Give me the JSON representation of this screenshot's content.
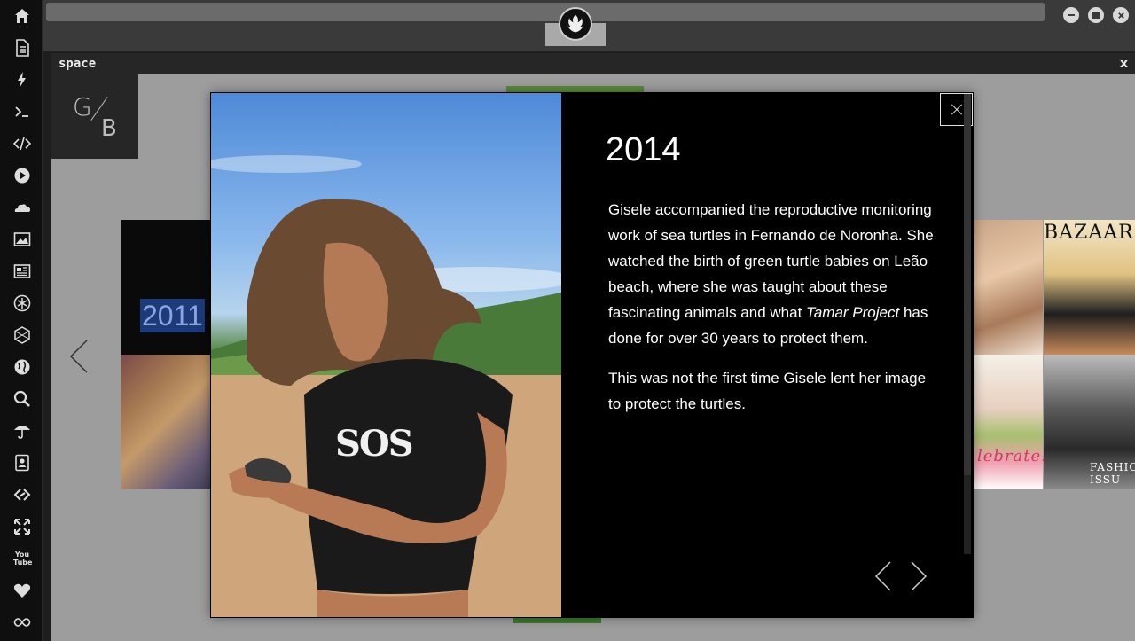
{
  "dock": {
    "items": [
      {
        "name": "home-icon"
      },
      {
        "name": "document-icon"
      },
      {
        "name": "lightning-icon"
      },
      {
        "name": "terminal-icon"
      },
      {
        "name": "code-icon"
      },
      {
        "name": "play-icon"
      },
      {
        "name": "cloud-icon"
      },
      {
        "name": "image-icon"
      },
      {
        "name": "news-icon"
      },
      {
        "name": "rebel-icon"
      },
      {
        "name": "hexagon-icon"
      },
      {
        "name": "globe-icon"
      },
      {
        "name": "search-icon"
      },
      {
        "name": "umbrella-icon"
      },
      {
        "name": "contacts-icon"
      },
      {
        "name": "link-icon"
      },
      {
        "name": "expand-icon"
      },
      {
        "name": "youtube-icon"
      },
      {
        "name": "heart-icon"
      },
      {
        "name": "infinity-icon"
      }
    ],
    "youtube_text": "You Tube"
  },
  "window": {
    "title": "space",
    "close_label": "x"
  },
  "logo": {
    "g": "G",
    "b": "B"
  },
  "timeline": {
    "year_label": "2011"
  },
  "magazines": {
    "bazaar_label": "BAZAAR",
    "fashion_label": "FASHION ISSU",
    "celebrate_label": "lebrate!"
  },
  "modal": {
    "year": "2014",
    "paragraph1_a": "Gisele accompanied the reproductive monitoring work of sea turtles in Fernando de Noronha. She watched the birth of green turtle babies on Leão beach, where she was taught about these fascinating animals and what ",
    "paragraph1_em": "Tamar Project",
    "paragraph1_b": " has done for over 30 years to protect them.",
    "paragraph2": "This was not the first time Gisele lent her image to protect the turtles.",
    "shirt_text": "SOS"
  },
  "colors": {
    "dock_bg": "#0f0f0f",
    "window_bg": "#9d9d9d",
    "modal_bg": "#000000",
    "selection_blue": "#1d3a7a"
  }
}
